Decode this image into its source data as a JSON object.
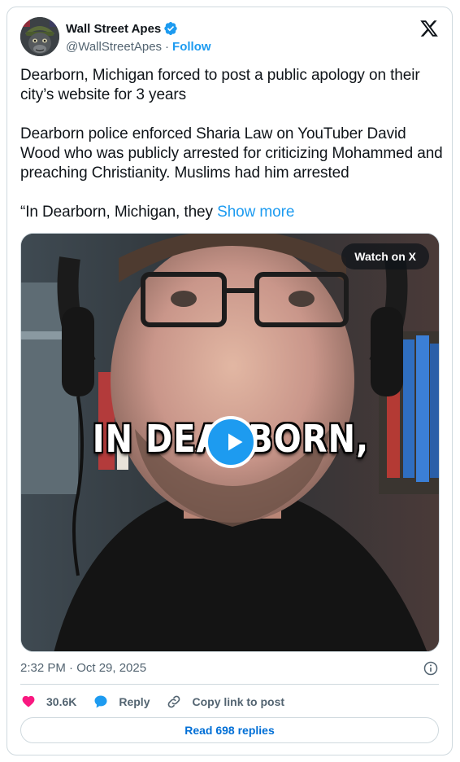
{
  "author": {
    "display_name": "Wall Street Apes",
    "handle": "@WallStreetApes",
    "separator": "·",
    "follow_label": "Follow"
  },
  "tweet": {
    "paragraphs": [
      "Dearborn, Michigan forced to post a public apology on their city’s website for 3 years",
      "Dearborn police enforced Sharia Law on YouTuber David Wood who was publicly arrested for criticizing Mohammed and preaching Christianity. Muslims had him arrested",
      "“In Dearborn, Michigan, they"
    ],
    "show_more_label": "Show more"
  },
  "media": {
    "watch_label": "Watch on X",
    "caption": "IN DEARBORN,"
  },
  "timestamp": "2:32 PM · Oct 29, 2025",
  "actions": {
    "like_count": "30.6K",
    "reply_label": "Reply",
    "copy_link_label": "Copy link to post"
  },
  "read_replies_label": "Read 698 replies",
  "colors": {
    "accent": "#1d9bf0",
    "like": "#f91880",
    "text_secondary": "#536471",
    "border": "#cfd9de"
  }
}
